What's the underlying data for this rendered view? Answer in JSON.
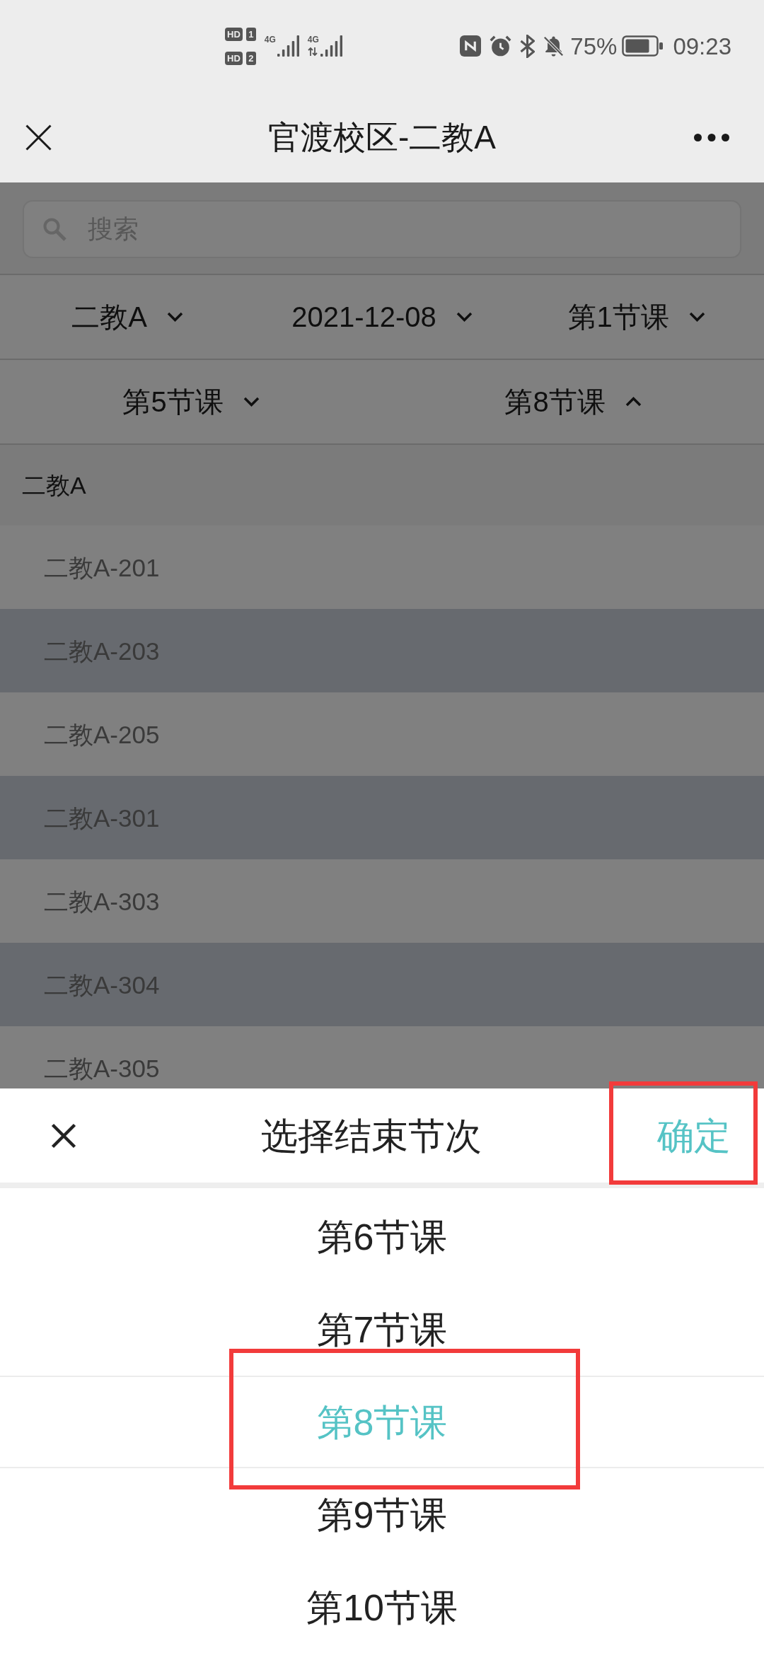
{
  "status_bar": {
    "sims": [
      {
        "badge": "HD",
        "slot": "1",
        "network": "4G",
        "data_active": false
      },
      {
        "badge": "HD",
        "slot": "2",
        "network": "4G",
        "data_active": true
      }
    ],
    "battery": "75%",
    "time": "09:23"
  },
  "nav_bar": {
    "title": "官渡校区-二教A"
  },
  "search": {
    "placeholder": "搜索"
  },
  "filter_rows": [
    {
      "items": [
        {
          "label": "二教A",
          "expanded": false
        },
        {
          "label": "2021-12-08",
          "expanded": false
        },
        {
          "label": "第1节课",
          "expanded": false
        }
      ]
    },
    {
      "items": [
        {
          "label": "第5节课",
          "expanded": false
        },
        {
          "label": "第8节课",
          "expanded": true
        }
      ]
    }
  ],
  "room_list": [
    {
      "label": "二教A",
      "children": [
        {
          "label": "二教A-201"
        },
        {
          "label": "二教A-203"
        },
        {
          "label": "二教A-205"
        },
        {
          "label": "二教A-301"
        },
        {
          "label": "二教A-303"
        },
        {
          "label": "二教A-304"
        },
        {
          "label": "二教A-305"
        }
      ]
    }
  ],
  "picker_sheet": {
    "title": "选择结束节次",
    "confirm": {
      "label": "确定",
      "annotated": true
    },
    "options": [
      {
        "label": "第6节课",
        "selected": false,
        "annotated": false
      },
      {
        "label": "第7节课",
        "selected": false,
        "annotated": false
      },
      {
        "label": "第8节课",
        "selected": true,
        "annotated": true
      },
      {
        "label": "第9节课",
        "selected": false,
        "annotated": false
      },
      {
        "label": "第10节课",
        "selected": false,
        "annotated": false
      }
    ]
  }
}
